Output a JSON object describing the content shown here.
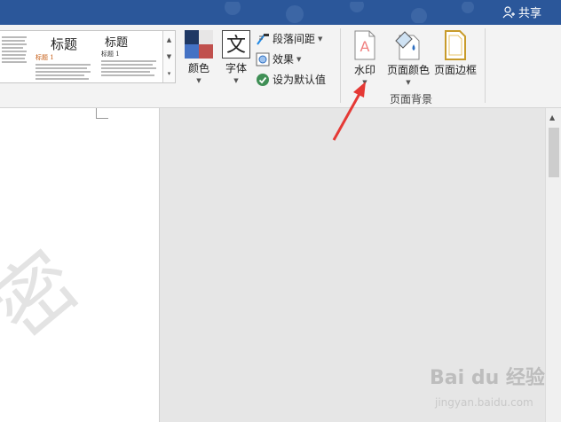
{
  "titlebar": {
    "share_label": "共享"
  },
  "gallery": {
    "thumb1": {
      "title": "标题",
      "text": "在\"插入\"选项卡上，库包括的项目旨在与文档的整体外观相协调。"
    },
    "thumb2": {
      "title": "标题",
      "subtitle": "标题 1",
      "text": "对于\"插入\"选项卡上的库，在设计时都充分考虑了其中的项与文档整体外观的协调性。"
    },
    "thumb3": {
      "title": "标题",
      "subtitle": "标题 1",
      "text": "对于\"插入\"选项卡上的库，在设计时都充分考虑了其中的项与文档整体外观的协调性。"
    }
  },
  "ribbon": {
    "colors_label": "颜色",
    "fonts_label": "字体",
    "paragraph_spacing_label": "段落间距",
    "effects_label": "效果",
    "set_default_label": "设为默认值",
    "watermark_label": "水印",
    "page_color_label": "页面颜色",
    "page_borders_label": "页面边框",
    "page_background_group": "页面背景"
  },
  "document": {
    "watermark_text": "密"
  },
  "overlay": {
    "brand": "Bai du 经验",
    "url": "jingyan.baidu.com"
  },
  "colors": {
    "titlebar": "#2b579a",
    "accent_arrow": "#e53935"
  }
}
